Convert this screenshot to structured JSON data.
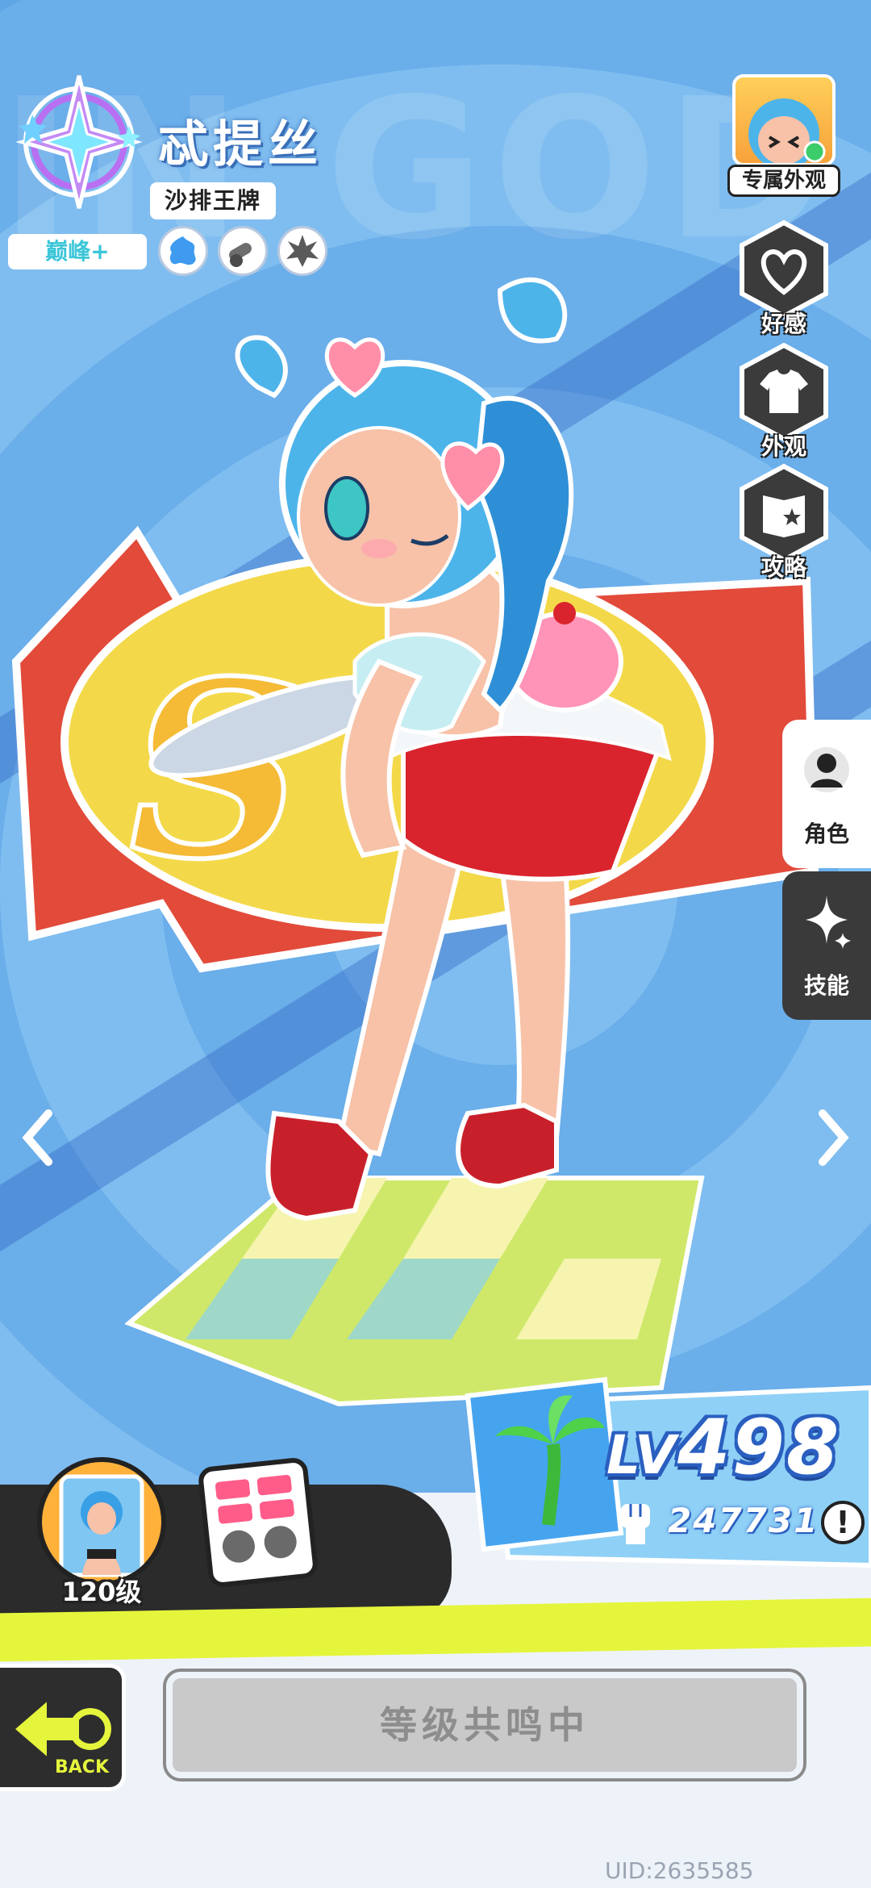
{
  "character": {
    "name": "忒提丝",
    "title_tag": "沙排王牌",
    "rank": "巅峰+"
  },
  "outfit_button": {
    "label": "专属外观"
  },
  "side_buttons": [
    {
      "label": "好感",
      "icon": "heart-icon"
    },
    {
      "label": "外观",
      "icon": "shirt-icon"
    },
    {
      "label": "攻略",
      "icon": "guide-book-icon"
    }
  ],
  "tabs": [
    {
      "label": "角色",
      "icon": "person-icon",
      "active": true
    },
    {
      "label": "技能",
      "icon": "sparkle-icon",
      "active": false
    }
  ],
  "level": {
    "prefix": "LV",
    "value": "498",
    "power": "247731",
    "info_symbol": "!"
  },
  "skin": {
    "level_label": "120级"
  },
  "back_label": "BACK",
  "resonance_label": "等级共鸣中",
  "uid": "UID:2635585",
  "colors": {
    "background": "#5fa6e6",
    "accent_lime": "#e5f53c",
    "button_disabled": "#c9c9c9"
  }
}
